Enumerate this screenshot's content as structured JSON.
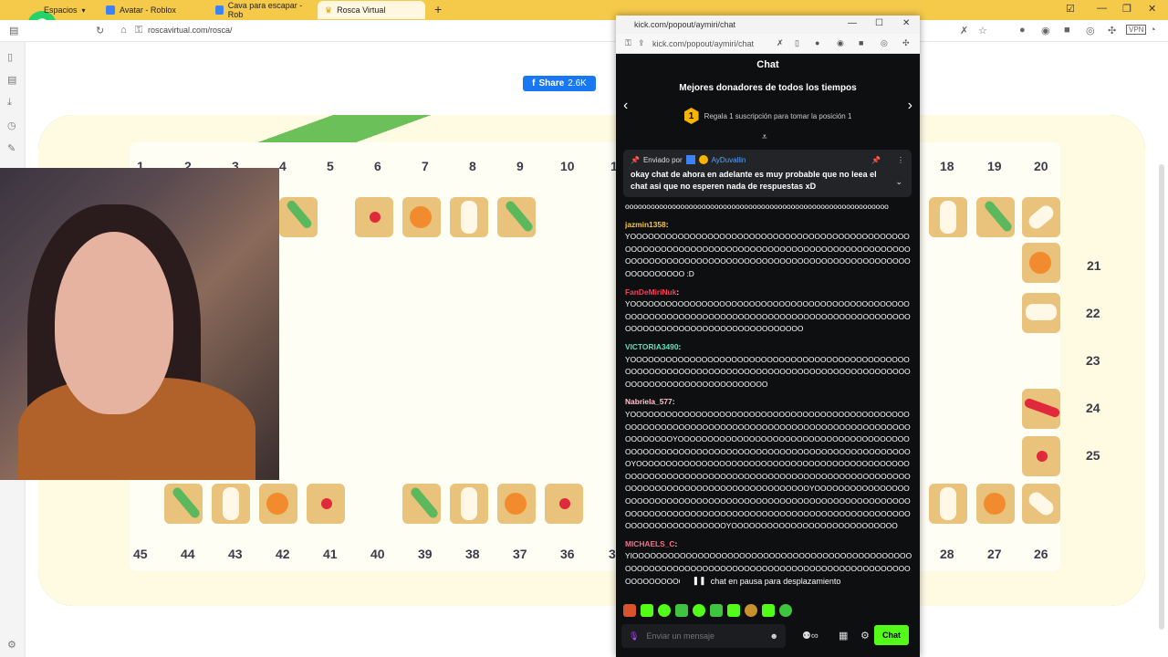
{
  "browser": {
    "tabs": [
      {
        "label": "Espacios",
        "active": false
      },
      {
        "label": "Avatar - Roblox",
        "active": false
      },
      {
        "label": "Cava para escapar - Rob",
        "active": false
      },
      {
        "label": "Rosca Virtual",
        "active": true
      }
    ],
    "url": "roscavirtual.com/rosca/"
  },
  "page": {
    "share_label": "Share",
    "share_count": "2.6K",
    "top_numbers": [
      "1",
      "2",
      "3",
      "4",
      "5",
      "6",
      "7",
      "8",
      "9",
      "10",
      "1",
      "18",
      "19",
      "20"
    ],
    "right_numbers": [
      "21",
      "22",
      "23",
      "24",
      "25"
    ],
    "bottom_numbers": [
      "45",
      "44",
      "43",
      "42",
      "41",
      "40",
      "39",
      "38",
      "37",
      "36",
      "3",
      "28",
      "27",
      "26"
    ]
  },
  "popup": {
    "url": "kick.com/popout/aymiri/chat",
    "title_url": "kick.com/popout/aymiri/chat",
    "chat_title": "Chat",
    "donors_title": "Mejores donadores de todos los tiempos",
    "donors_rank": "1",
    "donors_sub": "Regala 1 suscripción para tomar la posición 1",
    "pinned": {
      "sent_by": "Enviado por",
      "user": "AyDuvallin",
      "message": "okay chat de ahora en adelante es muy probable que no leea el chat asi que no esperen nada de respuestas xD"
    },
    "messages": [
      {
        "user": "",
        "color": "#ffffff",
        "text": "oooooooooooooooooooooooooooooooooooooooooooooooooooooooooooooo"
      },
      {
        "user": "jazmin1358",
        "color": "#f5c542",
        "text": "YOOOOOOOOOOOOOOOOOOOOOOOOOOOOOOOOOOOOOOOOOOOOOOOOOOOOOOOOOOOOOOOOOOOOOOOOOOOOOOOOOOOOOOOOOOOOOOOOOOOOOOOOOOOOOOOOOOOOOOOOOOOOOOOOOOOOOOOOOOOOOOOOOOOOOOOOO :D"
      },
      {
        "user": "FanDeMiriNuk",
        "color": "#ff3b5c",
        "text": "YOOOOOOOOOOOOOOOOOOOOOOOOOOOOOOOOOOOOOOOOOOOOOOOOOOOOOOOOOOOOOOOOOOOOOOOOOOOOOOOOOOOOOOOOOOOOOOOOOOOOOOOOOOOOOOOOOOOOOOOOOOOOO"
      },
      {
        "user": "VICTORIA3490",
        "color": "#5ce1b5",
        "text": "YOOOOOOOOOOOOOOOOOOOOOOOOOOOOOOOOOOOOOOOOOOOOOOOOOOOOOOOOOOOOOOOOOOOOOOOOOOOOOOOOOOOOOOOOOOOOOOOOOOOOOOOOOOOOOOOOOOOOOOO"
      },
      {
        "user": "Nabriela_577",
        "color": "#ffc0cb",
        "text": "YOOOOOOOOOOOOOOOOOOOOOOOOOOOOOOOOOOOOOOOOOOOOOOOOOOOOOOOOOOOOOOOOOOOOOOOOOOOOOOOOOOOOOOOOOOOOOOOOOOOOOOOYOOOOOOOOOOOOOOOOOOOOOOOOOOOOOOOOOOOOOOOOOOOOOOOOOOOOOOOOOOOOOOOOOOOOOOOOOOOOOOOOOOOOOOOOYOOOOOOOOOOOOOOOOOOOOOOOOOOOOOOOOOOOOOOOOOOOOOOOOOOOOOOOOOOOOOOOOOOOOOOOOOOOOOOOOOOOOOOOOOOOOOOOOOOOOOOOOOOOOOOOOOOOOOOOOOOOOOYOOOOOOOOOOOOOOOOOOOOOOOOOOOOOOOOOOOOOOOOOOOOOOOOOOOOOOOOOOOOOOOOOOOOOOOOOOOOOOOOOOOOOOOOOOOOOOOOOOOOOOOOOOOOOOOOOOOOOOOOOOOOOOOOOYOOOOOOOOOOOOOOOOOOOOOOOOOOOO"
      },
      {
        "user": "MICHAELS_C",
        "color": "#ff6b8a",
        "text": "YIOOOOOOOOOOOOOOOOOOOOOOOOOOOOOOOOOOOOOOOOOOOOOOOOOOOOOOOOOOOOOOOOOOOOOOOOOOOOOOOOOOOOOOOOOOOOOOOOOOOOOOOOOOOOOOOOOOOOOOOO"
      }
    ],
    "pause_label": "chat en pausa para desplazamiento",
    "input_placeholder": "Enviar un mensaje",
    "chat_button": "Chat"
  }
}
